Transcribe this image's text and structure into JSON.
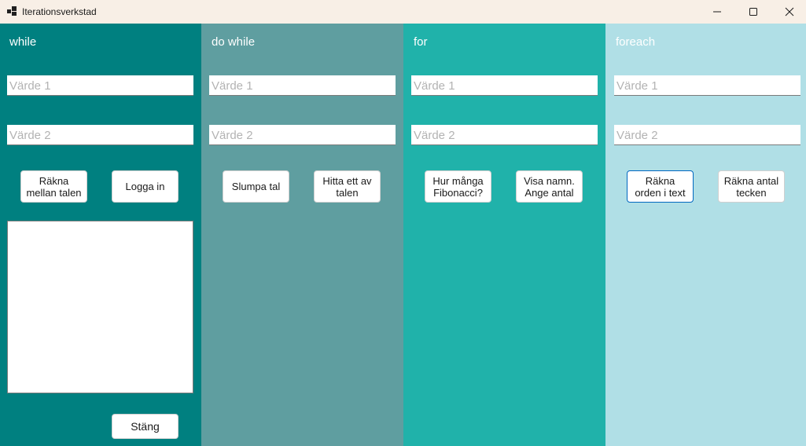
{
  "window": {
    "title": "Iterationsverkstad",
    "icon": "app-window-icon",
    "controls": [
      "minimize-icon",
      "maximize-icon",
      "close-icon"
    ]
  },
  "colors": {
    "titlebar": "#f8efe6",
    "panel_while": "#008080",
    "panel_do_while": "#5f9ea0",
    "panel_for": "#20b2aa",
    "panel_foreach": "#b0dfe6"
  },
  "panels": [
    {
      "title": "while",
      "field1_placeholder": "Värde 1",
      "field2_placeholder": "Värde 2",
      "buttons": [
        "Räkna\nmellan talen",
        "Logga in"
      ],
      "close_button": "Stäng"
    },
    {
      "title": "do while",
      "field1_placeholder": "Värde 1",
      "field2_placeholder": "Värde 2",
      "buttons": [
        "Slumpa tal",
        "Hitta ett av\ntalen"
      ]
    },
    {
      "title": "for",
      "field1_placeholder": "Värde 1",
      "field2_placeholder": "Värde 2",
      "buttons": [
        "Hur många\nFibonacci?",
        "Visa namn.\nAnge antal"
      ]
    },
    {
      "title": "foreach",
      "field1_placeholder": "Värde 1",
      "field2_placeholder": "Värde 2",
      "buttons": [
        "Räkna\norden i text",
        "Räkna antal\ntecken"
      ]
    }
  ]
}
